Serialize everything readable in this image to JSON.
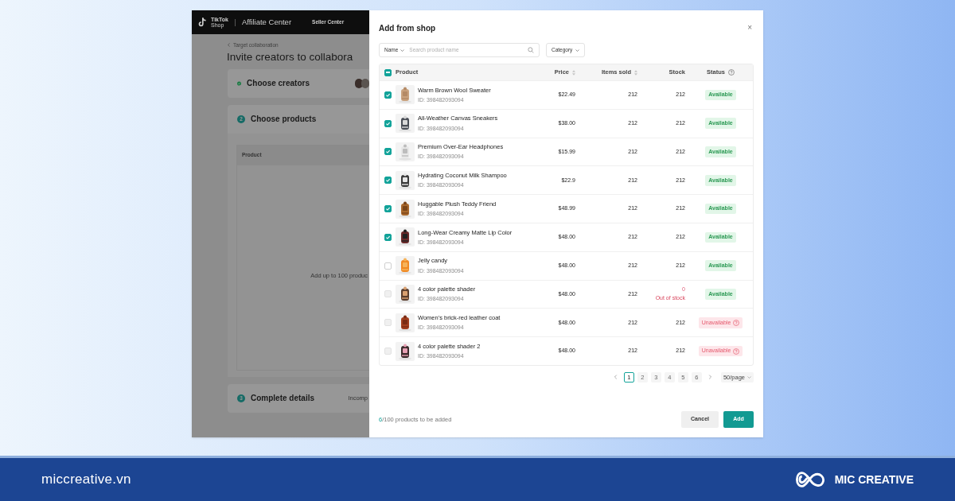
{
  "background_page": {
    "header": {
      "logo_top": "TikTok",
      "logo_bottom": "Shop",
      "title": "Affiliate Center",
      "link": "Seller Center"
    },
    "breadcrumb": "Target collaboration",
    "title": "Invite creators to collabora",
    "steps": [
      {
        "kind": "creators",
        "done": true,
        "title": "Choose creators"
      },
      {
        "kind": "products",
        "number": "2",
        "done": false,
        "title": "Choose products",
        "table_header": "Product",
        "empty_text": "Add up to 100 produc"
      },
      {
        "kind": "details",
        "number": "3",
        "done": false,
        "title": "Complete details",
        "status": "Incomp"
      }
    ]
  },
  "modal": {
    "title": "Add from shop",
    "close": "×",
    "search": {
      "filter": "Name",
      "placeholder": "Search product name"
    },
    "category": "Category",
    "table": {
      "columns": [
        {
          "label": "Product",
          "kind": "plain"
        },
        {
          "label": "Price",
          "kind": "sortable"
        },
        {
          "label": "Items sold",
          "kind": "sortable"
        },
        {
          "label": "Stock",
          "kind": "plain"
        },
        {
          "label": "Status",
          "kind": "help"
        }
      ],
      "select_all": {
        "indeterminate": true
      },
      "rows": [
        {
          "name": "Warm Brown Wool Sweater",
          "id": "ID: 398482093094",
          "price": "$22.49",
          "sold": "212",
          "stock": "212",
          "out_of_stock": false,
          "status": "Available",
          "kind": "available",
          "checked": true,
          "disabled": false
        },
        {
          "name": "All-Weather Canvas Sneakers",
          "id": "ID: 398482093094",
          "price": "$38.00",
          "sold": "212",
          "stock": "212",
          "out_of_stock": false,
          "status": "Available",
          "kind": "available",
          "checked": true,
          "disabled": false
        },
        {
          "name": "Premium Over-Ear Headphones",
          "id": "ID: 398482093094",
          "price": "$15.99",
          "sold": "212",
          "stock": "212",
          "out_of_stock": false,
          "status": "Available",
          "kind": "available",
          "checked": true,
          "disabled": false
        },
        {
          "name": "Hydrating Coconut Milk Shampoo",
          "id": "ID: 398482093094",
          "price": "$22.9",
          "sold": "212",
          "stock": "212",
          "out_of_stock": false,
          "status": "Available",
          "kind": "available",
          "checked": true,
          "disabled": false
        },
        {
          "name": "Huggable Plush Teddy Friend",
          "id": "ID: 398482093094",
          "price": "$48.99",
          "sold": "212",
          "stock": "212",
          "out_of_stock": false,
          "status": "Available",
          "kind": "available",
          "checked": true,
          "disabled": false
        },
        {
          "name": "Long-Wear Creamy Matte Lip Color",
          "id": "ID: 398482093094",
          "price": "$48.00",
          "sold": "212",
          "stock": "212",
          "out_of_stock": false,
          "status": "Available",
          "kind": "available",
          "checked": true,
          "disabled": false
        },
        {
          "name": "Jelly candy",
          "id": "ID: 398482093094",
          "price": "$48.00",
          "sold": "212",
          "stock": "212",
          "out_of_stock": false,
          "status": "Available",
          "kind": "available",
          "checked": false,
          "disabled": false
        },
        {
          "name": "4 color palette shader",
          "id": "ID: 398482093094",
          "price": "$48.00",
          "sold": "212",
          "stock": "0",
          "stock_note": "Out of stock",
          "out_of_stock": true,
          "status": "Available",
          "kind": "available",
          "checked": false,
          "disabled": true
        },
        {
          "name": "Women's brick-red leather coat",
          "id": "ID: 398482093094",
          "price": "$48.00",
          "sold": "212",
          "stock": "212",
          "out_of_stock": false,
          "status": "Unavailable",
          "kind": "unavailable",
          "checked": false,
          "disabled": true
        },
        {
          "name": "4 color palette shader 2",
          "id": "ID: 398482093094",
          "price": "$48.00",
          "sold": "212",
          "stock": "212",
          "out_of_stock": false,
          "status": "Unavailable",
          "kind": "unavailable",
          "checked": false,
          "disabled": true
        }
      ]
    },
    "pagination": {
      "pages": [
        {
          "label": "1",
          "selected": true
        },
        {
          "label": "2",
          "selected": false
        },
        {
          "label": "3",
          "selected": false
        },
        {
          "label": "4",
          "selected": false
        },
        {
          "label": "5",
          "selected": false
        },
        {
          "label": "6",
          "selected": false
        }
      ],
      "page_size": "50/page"
    },
    "footer": {
      "count": "6",
      "count_rest": "/100 products to be added",
      "buttons": [
        {
          "label": "Cancel",
          "kind": "secondary"
        },
        {
          "label": "Add",
          "kind": "primary"
        }
      ]
    }
  },
  "banner": {
    "site": "miccreative.vn",
    "brand": "MIC CREATIVE"
  }
}
